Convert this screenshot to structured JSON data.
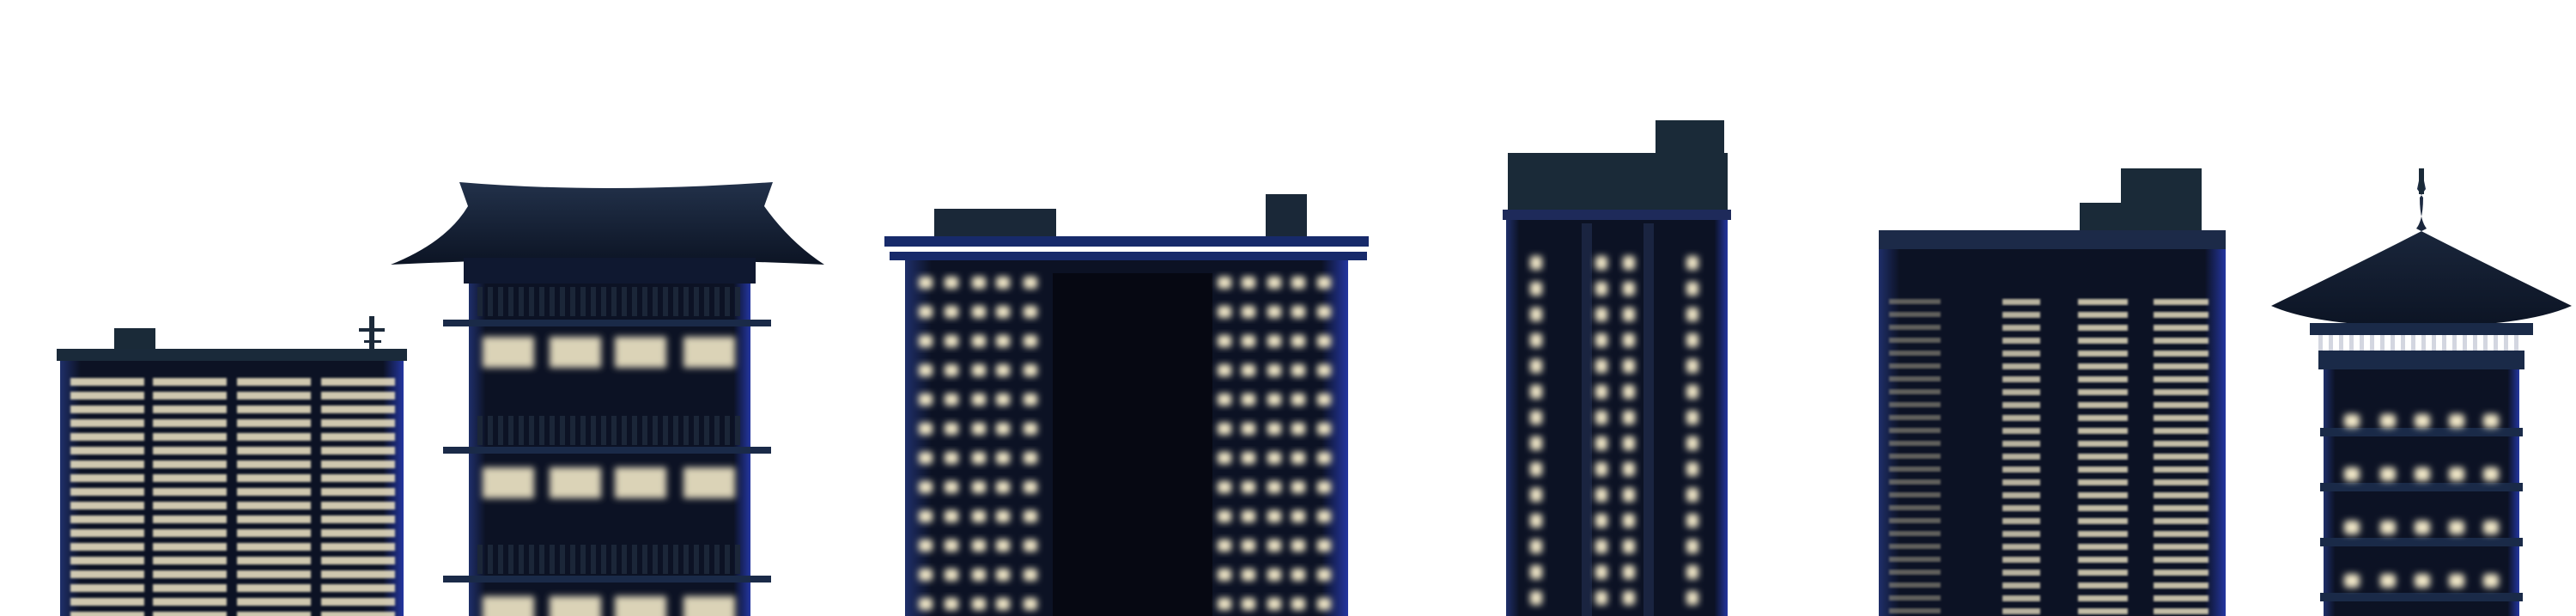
{
  "scene": {
    "background": "#ffffff",
    "building_fill": "#0d1424",
    "building_fill_light": "#1a2840",
    "rim_glow": "#2b3ccf",
    "window_glow": "#f2e8c8",
    "window_glow_dim": "#9a9482"
  },
  "buildings": [
    {
      "id": "office-low-rise",
      "kind": "office block with antenna"
    },
    {
      "id": "pagoda-roof-tower",
      "kind": "tiered building with curved roof"
    },
    {
      "id": "twin-column-block",
      "kind": "wide block with dark center"
    },
    {
      "id": "slim-tower",
      "kind": "tall narrow tower"
    },
    {
      "id": "stepped-tower",
      "kind": "stepped office tower"
    },
    {
      "id": "pagoda-tower",
      "kind": "round tower with pagoda spire"
    }
  ]
}
